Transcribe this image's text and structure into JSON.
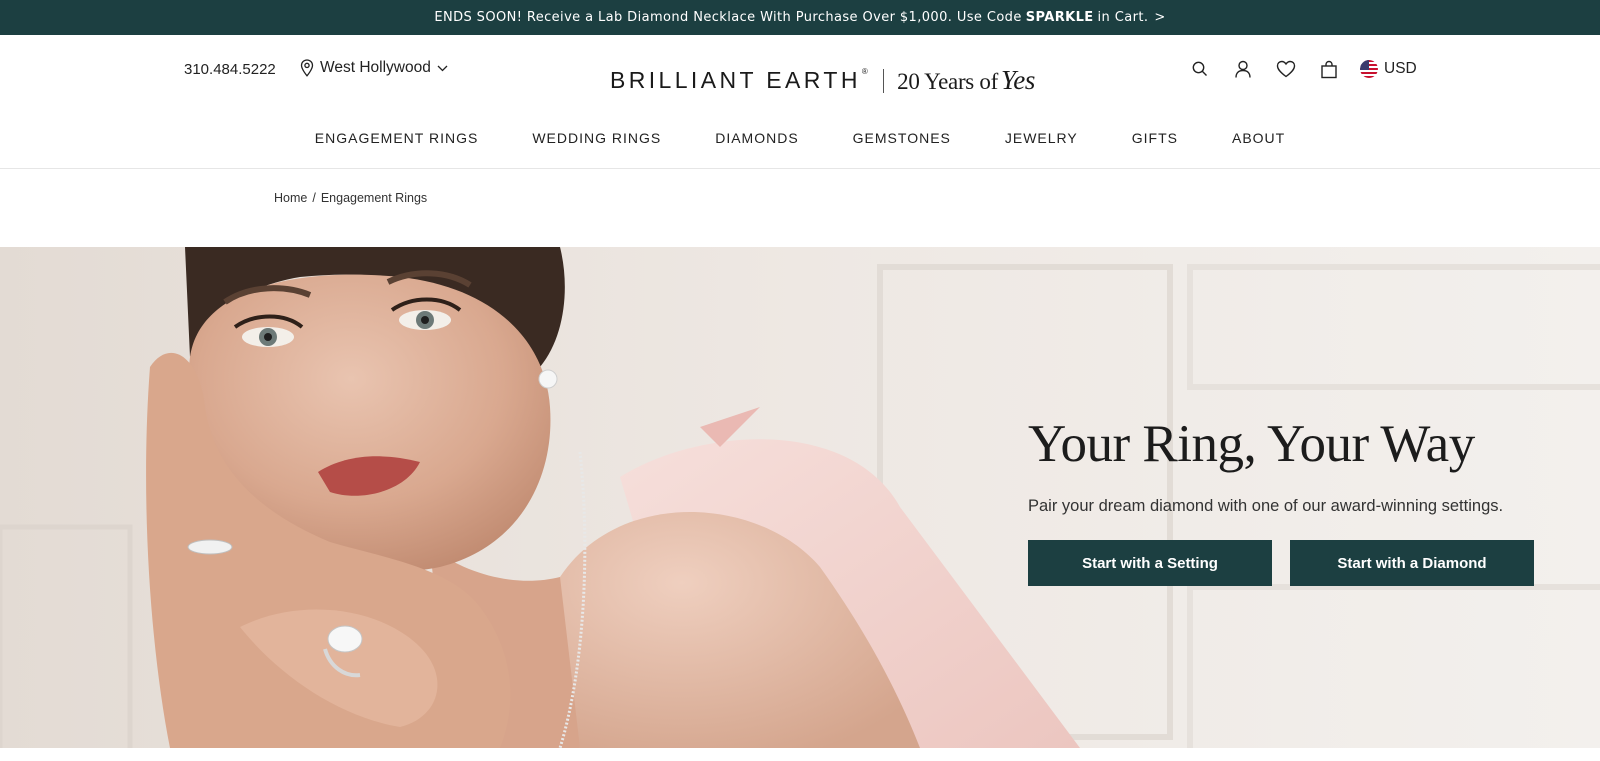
{
  "promo": {
    "text_before": "ENDS SOON! Receive a Lab Diamond Necklace With Purchase Over $1,000. Use Code",
    "code": "SPARKLE",
    "text_after": "in Cart.",
    "arrow": ">"
  },
  "header": {
    "phone": "310.484.5222",
    "location": "West Hollywood",
    "logo_brand": "BRILLIANT EARTH",
    "logo_reg": "®",
    "logo_tagline": "20 Years of",
    "logo_tagline_script": "Yes",
    "currency": "USD",
    "icons": [
      "search-icon",
      "account-icon",
      "wishlist-heart-icon",
      "shopping-bag-icon",
      "us-flag-icon"
    ]
  },
  "nav": {
    "items": [
      "ENGAGEMENT RINGS",
      "WEDDING RINGS",
      "DIAMONDS",
      "GEMSTONES",
      "JEWELRY",
      "GIFTS",
      "ABOUT"
    ]
  },
  "breadcrumb": {
    "home": "Home",
    "separator": "/",
    "current": "Engagement Rings"
  },
  "hero": {
    "title": "Your Ring, Your Way",
    "subtitle": "Pair your dream diamond with one of our award-winning settings.",
    "primary_button": "Start with a Setting",
    "secondary_button": "Start with a Diamond"
  },
  "colors": {
    "brand_green": "#1c3f41",
    "text": "#222222",
    "divider": "#e6e6e6"
  }
}
